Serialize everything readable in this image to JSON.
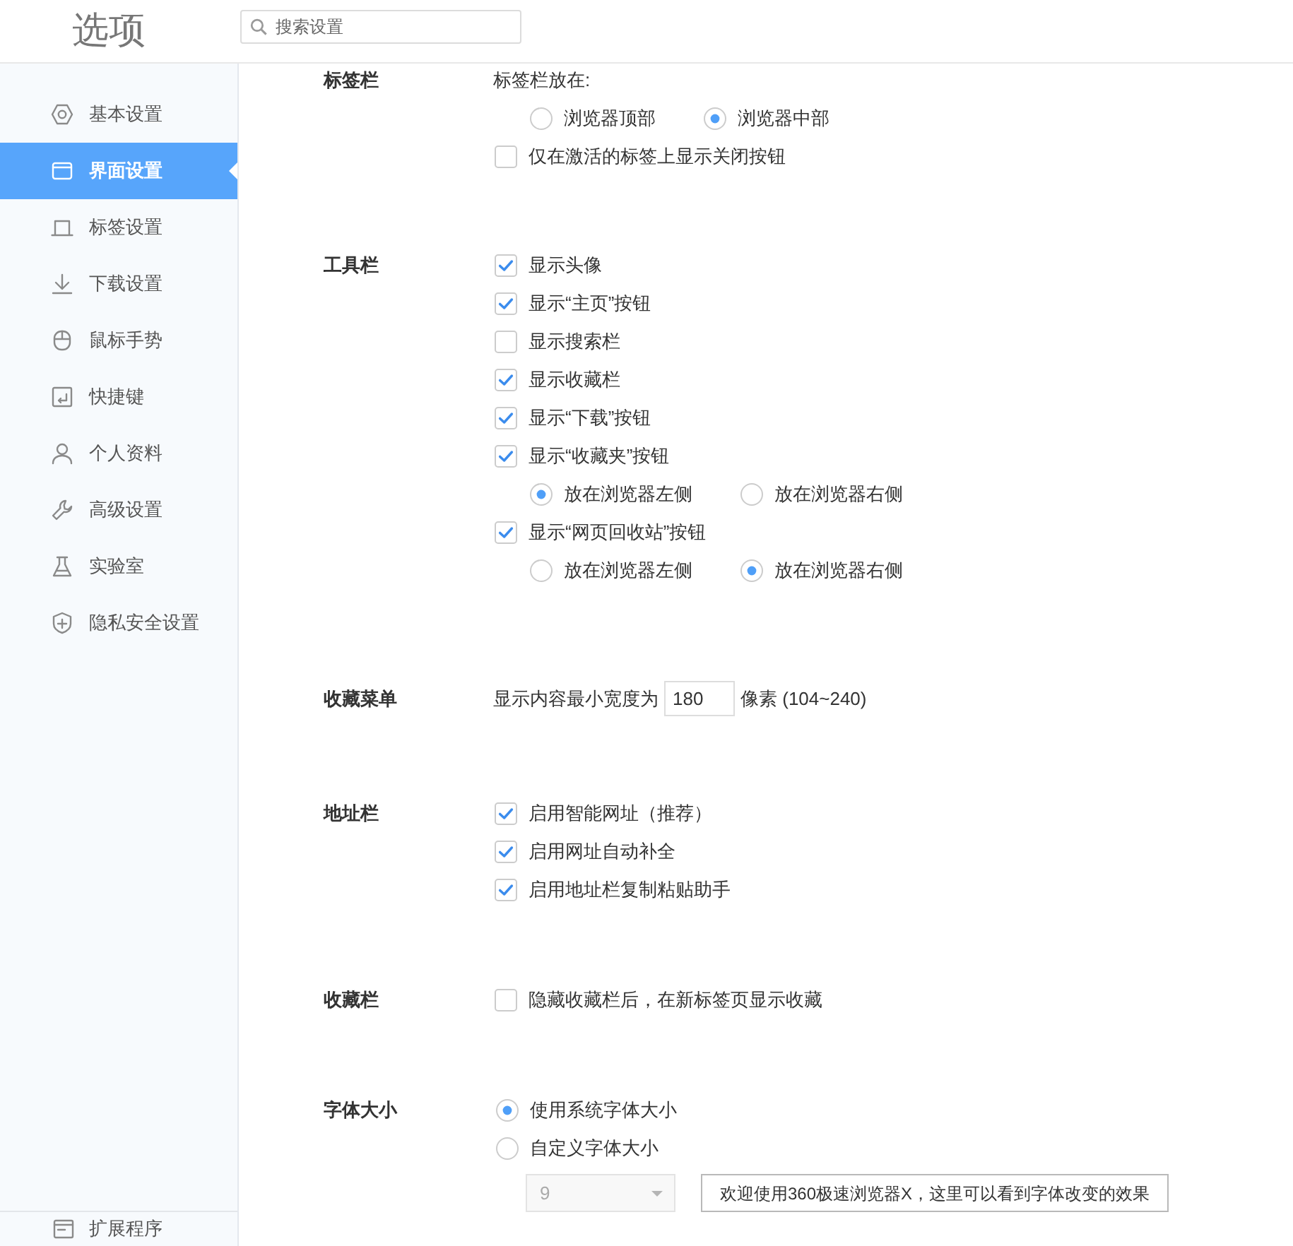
{
  "header": {
    "title": "选项",
    "search": {
      "placeholder": "搜索设置"
    }
  },
  "sidebar": {
    "items": [
      {
        "label": "基本设置",
        "selected": false
      },
      {
        "label": "界面设置",
        "selected": true
      },
      {
        "label": "标签设置",
        "selected": false
      },
      {
        "label": "下载设置",
        "selected": false
      },
      {
        "label": "鼠标手势",
        "selected": false
      },
      {
        "label": "快捷键",
        "selected": false
      },
      {
        "label": "个人资料",
        "selected": false
      },
      {
        "label": "高级设置",
        "selected": false
      },
      {
        "label": "实验室",
        "selected": false
      },
      {
        "label": "隐私安全设置",
        "selected": false
      }
    ],
    "footer_item": {
      "label": "扩展程序"
    }
  },
  "sections": [
    {
      "label": "标签栏",
      "rows": [
        {
          "kind": "text",
          "text": "标签栏放在:"
        },
        {
          "kind": "radio_group",
          "options": [
            {
              "label": "浏览器顶部",
              "selected": false
            },
            {
              "label": "浏览器中部",
              "selected": true
            }
          ]
        },
        {
          "kind": "checkbox",
          "label": "仅在激活的标签上显示关闭按钮",
          "checked": false
        }
      ]
    },
    {
      "label": "工具栏",
      "rows": [
        {
          "kind": "checkbox",
          "label": "显示头像",
          "checked": true
        },
        {
          "kind": "checkbox",
          "label": "显示“主页”按钮",
          "checked": true
        },
        {
          "kind": "checkbox",
          "label": "显示搜索栏",
          "checked": false
        },
        {
          "kind": "checkbox",
          "label": "显示收藏栏",
          "checked": true
        },
        {
          "kind": "checkbox",
          "label": "显示“下载”按钮",
          "checked": true
        },
        {
          "kind": "checkbox",
          "label": "显示“收藏夹”按钮",
          "checked": true
        },
        {
          "kind": "radio_group",
          "options": [
            {
              "label": "放在浏览器左侧",
              "selected": true
            },
            {
              "label": "放在浏览器右侧",
              "selected": false
            }
          ]
        },
        {
          "kind": "checkbox",
          "label": "显示“网页回收站”按钮",
          "checked": true
        },
        {
          "kind": "radio_group",
          "options": [
            {
              "label": "放在浏览器左侧",
              "selected": false
            },
            {
              "label": "放在浏览器右侧",
              "selected": true
            }
          ]
        }
      ]
    },
    {
      "label": "收藏菜单",
      "rows": [
        {
          "kind": "number",
          "prefix": "显示内容最小宽度为",
          "value": "180",
          "suffix": "像素 (104~240)"
        }
      ]
    },
    {
      "label": "地址栏",
      "rows": [
        {
          "kind": "checkbox",
          "label": "启用智能网址（推荐）",
          "checked": true
        },
        {
          "kind": "checkbox",
          "label": "启用网址自动补全",
          "checked": true
        },
        {
          "kind": "checkbox",
          "label": "启用地址栏复制粘贴助手",
          "checked": true
        }
      ]
    },
    {
      "label": "收藏栏",
      "rows": [
        {
          "kind": "checkbox",
          "label": "隐藏收藏栏后，在新标签页显示收藏",
          "checked": false
        }
      ]
    },
    {
      "label": "字体大小",
      "rows": [
        {
          "kind": "radio",
          "label": "使用系统字体大小",
          "selected": true
        },
        {
          "kind": "radio",
          "label": "自定义字体大小",
          "selected": false
        },
        {
          "kind": "preview",
          "select": {
            "value": "9",
            "disabled": true
          },
          "button": "欢迎使用360极速浏览器X，这里可以看到字体改变的效果"
        }
      ]
    }
  ]
}
